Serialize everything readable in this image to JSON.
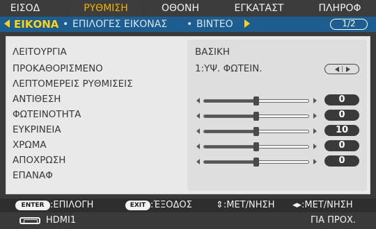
{
  "tabs": [
    "ΕΙΣΟΔ",
    "ΡΥΘΜΙΣΗ",
    "ΟΘΟΝΗ",
    "ΕΓΚΑΤΑΣΤ",
    "ΠΛΗΡΟΦ"
  ],
  "active_tab": "ΡΥΘΜΙΣΗ",
  "subnav": {
    "active": "ΕΙΚΟΝΑ",
    "item2": "ΕΠΙΛΟΓΕΣ ΕΙΚΟΝΑΣ",
    "item3": "ΒΙΝΤΕΟ",
    "page": "1/2"
  },
  "menu": {
    "mode_label": "ΛΕΙΤΟΥΡΓΙΑ",
    "mode_value": "ΒΑΣΙΚΗ",
    "preset_label": "ΠΡΟΚΑΘΟΡΙΣΜΕΝΟ",
    "preset_value": "1:ΥΨ. ΦΩΤΕΙΝ.",
    "detail_label": "ΛΕΠΤΟΜΕΡΕΙΣ ΡΥΘΜΙΣΕΙΣ",
    "reset_label": "ΕΠΑΝΑΦ"
  },
  "sliders": [
    {
      "label": "ΑΝΤΙΘΕΣΗ",
      "value": "0",
      "level": 0.5
    },
    {
      "label": "ΦΩΤΕΙΝΟΤΗΤΑ",
      "value": "0",
      "level": 0.5
    },
    {
      "label": "ΕΥΚΡΙΝΕΙΑ",
      "value": "10",
      "level": 0.5
    },
    {
      "label": "ΧΡΩΜΑ",
      "value": "0",
      "level": 0.5
    },
    {
      "label": "ΑΠΟΧΡΩΣΗ",
      "value": "0",
      "level": 0.5
    }
  ],
  "hints": {
    "enter_key": "ENTER",
    "enter_text": ":ΕΠΙΛΟΓΗ",
    "exit_key": "EXIT",
    "exit_text": ":ΈΞΟΔΟΣ",
    "move_text": "⇕:ΜΕΤ/ΝΗΣΗ",
    "adjust_text": "◂▸:ΜΕΤ/ΝΗΣΗ"
  },
  "status": {
    "input": "HDMI1",
    "mode": "ΓΙΑ ΠΡΟΧ."
  },
  "colors": {
    "accent": "#ffd21a",
    "subnav_bg": "#1d5d8f",
    "active_tab_text": "#f0b400"
  }
}
